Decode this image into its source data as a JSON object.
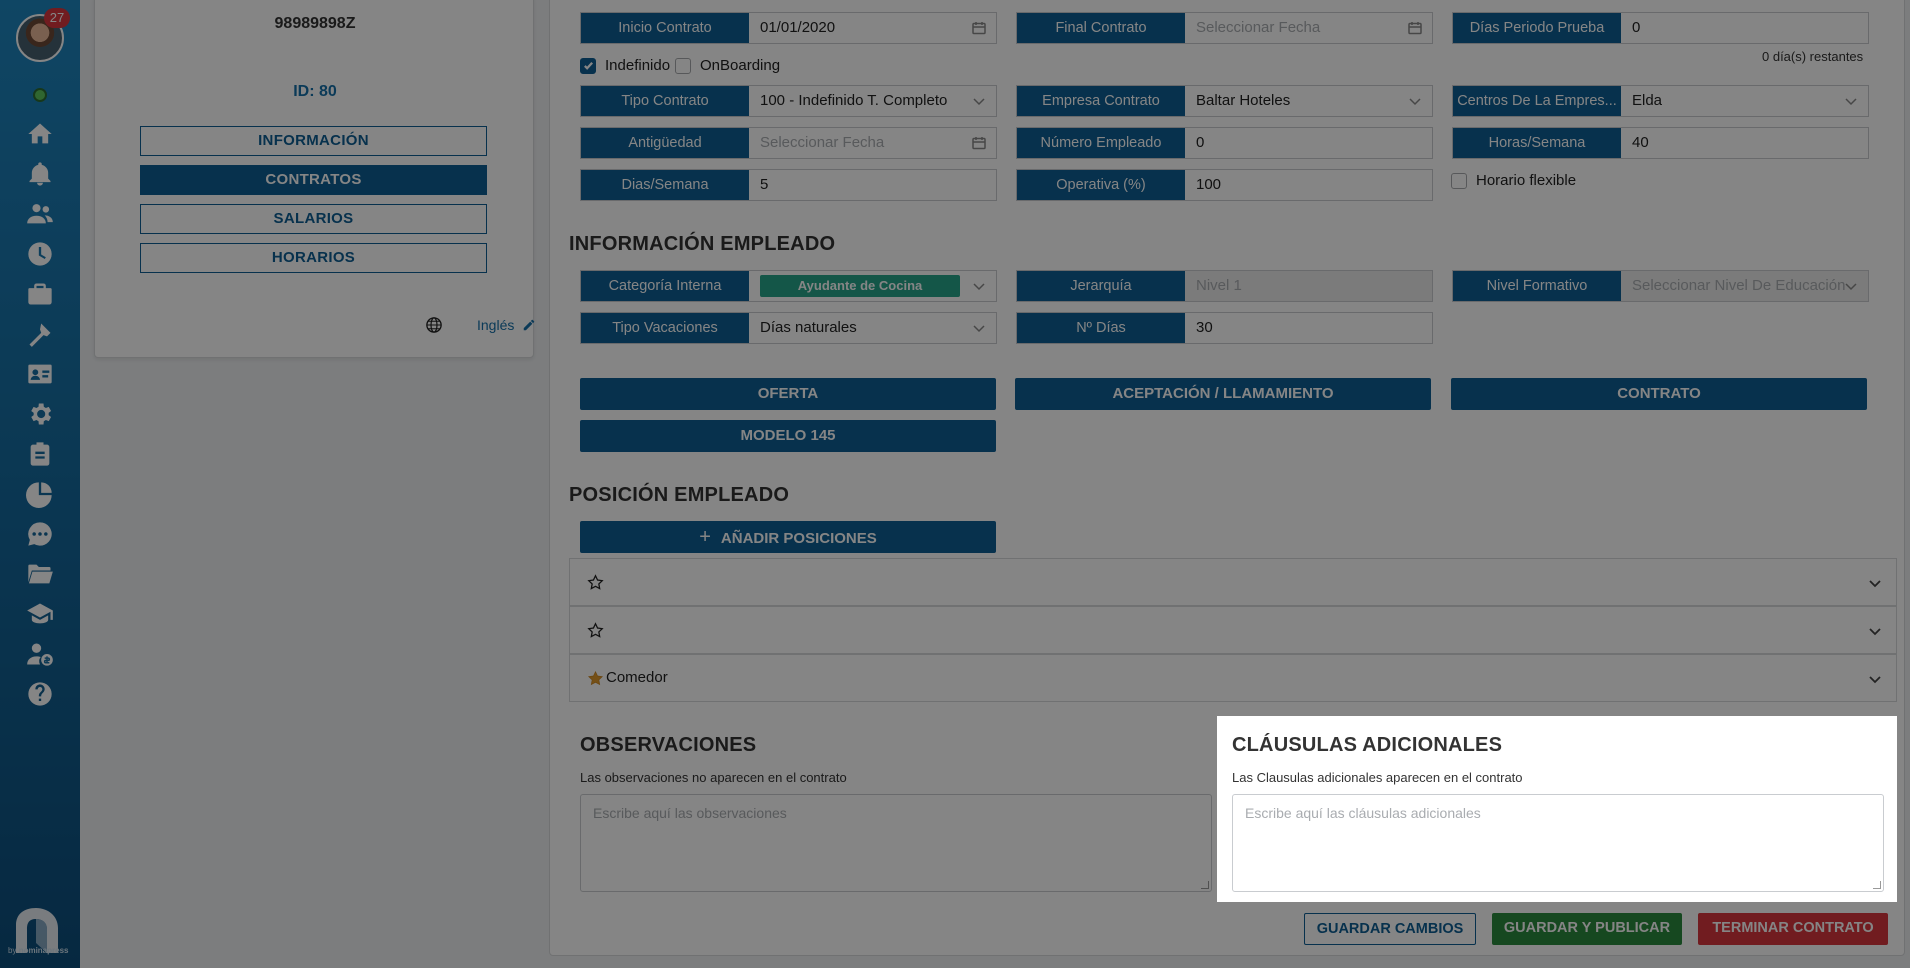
{
  "sidebar": {
    "notification_count": "27",
    "icons": [
      "home-icon",
      "bell-icon",
      "users-icon",
      "clock-icon",
      "briefcase-icon",
      "tools-icon",
      "id-card-icon",
      "gear-icon",
      "clipboard-icon",
      "pie-chart-icon",
      "chat-icon",
      "folder-icon",
      "graduation-cap-icon",
      "user-money-icon",
      "help-icon"
    ],
    "logo_byline": "by",
    "logo_brand": "nominapress"
  },
  "profile": {
    "document_id": "98989898Z",
    "employee_id": "ID: 80",
    "tabs": [
      "INFORMACIÓN",
      "CONTRATOS",
      "SALARIOS",
      "HORARIOS"
    ],
    "active_tab": "CONTRATOS",
    "language": "Inglés"
  },
  "contract": {
    "inicio_contrato": {
      "label": "Inicio Contrato",
      "value": "01/01/2020"
    },
    "final_contrato": {
      "label": "Final Contrato",
      "placeholder": "Seleccionar Fecha"
    },
    "dias_prueba": {
      "label": "Días Periodo Prueba",
      "value": "0"
    },
    "dias_restantes": "0 día(s) restantes",
    "indefinido": {
      "label": "Indefinido",
      "checked": true
    },
    "onboarding": {
      "label": "OnBoarding",
      "checked": false
    },
    "tipo_contrato": {
      "label": "Tipo Contrato",
      "value": "100 - Indefinido T. Completo"
    },
    "empresa_contrato": {
      "label": "Empresa Contrato",
      "value": "Baltar Hoteles"
    },
    "centros": {
      "label": "Centros De La Empres...",
      "value": "Elda"
    },
    "antiguedad": {
      "label": "Antigüedad",
      "placeholder": "Seleccionar Fecha"
    },
    "numero_empleado": {
      "label": "Número Empleado",
      "value": "0"
    },
    "horas_semana": {
      "label": "Horas/Semana",
      "value": "40"
    },
    "dias_semana": {
      "label": "Dias/Semana",
      "value": "5"
    },
    "operativa": {
      "label": "Operativa (%)",
      "value": "100"
    },
    "horario_flexible": {
      "label": "Horario flexible",
      "checked": false
    }
  },
  "employee_info": {
    "title": "INFORMACIÓN EMPLEADO",
    "categoria": {
      "label": "Categoría Interna",
      "value": "Ayudante de Cocina"
    },
    "jerarquia": {
      "label": "Jerarquía",
      "value": "Nivel 1"
    },
    "nivel_formativo": {
      "label": "Nivel Formativo",
      "placeholder": "Seleccionar Nivel De Educación"
    },
    "tipo_vacaciones": {
      "label": "Tipo Vacaciones",
      "value": "Días naturales"
    },
    "n_dias": {
      "label": "Nº Días",
      "value": "30"
    }
  },
  "documents": [
    "OFERTA",
    "ACEPTACIÓN / LLAMAMIENTO",
    "CONTRATO",
    "MODELO 145"
  ],
  "position": {
    "title": "POSICIÓN EMPLEADO",
    "add_label": "AÑADIR POSICIONES",
    "items": [
      {
        "label": "",
        "favorite": false
      },
      {
        "label": "",
        "favorite": false
      },
      {
        "label": "Comedor",
        "favorite": true
      }
    ]
  },
  "observaciones": {
    "title": "OBSERVACIONES",
    "note": "Las observaciones no aparecen en el contrato",
    "placeholder": "Escribe aquí las observaciones"
  },
  "clausulas": {
    "title": "CLÁUSULAS ADICIONALES",
    "note": "Las Clausulas adicionales aparecen en el contrato",
    "placeholder": "Escribe aquí las cláusulas adicionales"
  },
  "footer": {
    "save": "GUARDAR CAMBIOS",
    "save_publish": "GUARDAR Y PUBLICAR",
    "terminate": "TERMINAR CONTRATO"
  },
  "colors": {
    "primary": "#0e5f94",
    "success": "#2b8a3e",
    "danger": "#d9363e",
    "badge": "#27a58a"
  }
}
